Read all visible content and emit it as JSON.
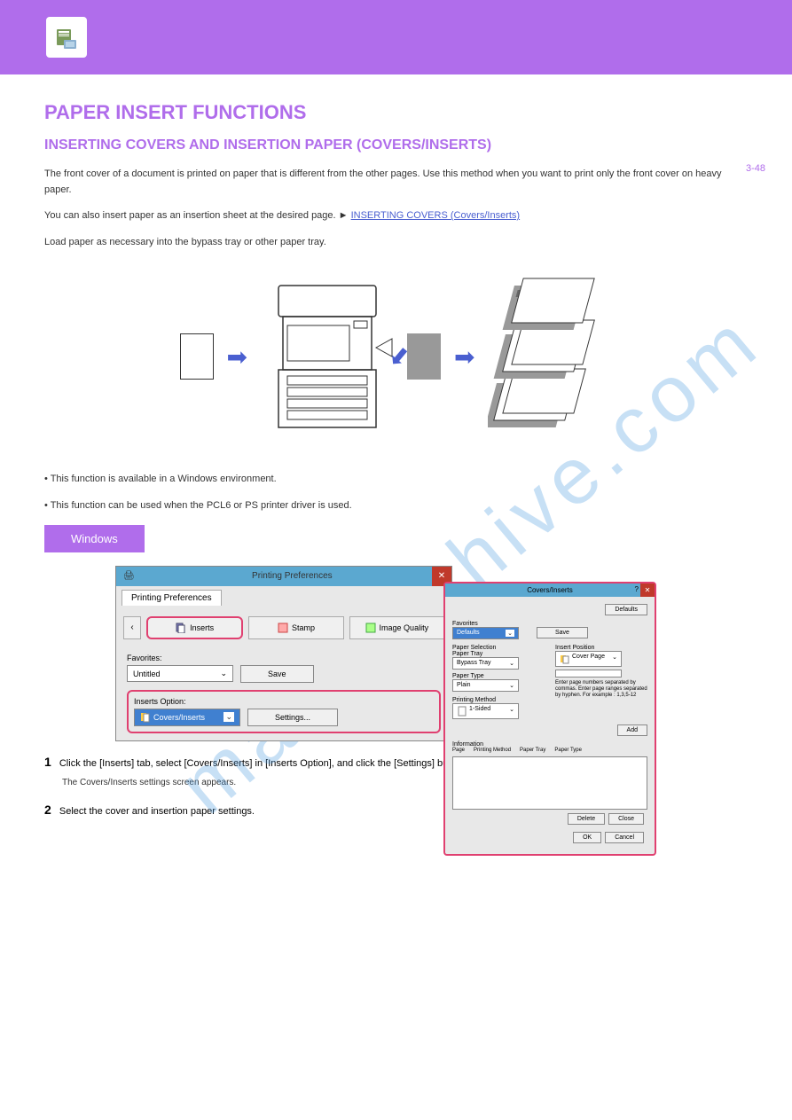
{
  "header": {
    "page_ref": "3-48"
  },
  "section": {
    "title": "PAPER INSERT FUNCTIONS",
    "subtitle": "INSERTING COVERS AND INSERTION PAPER (COVERS/INSERTS)",
    "link_text": "INSERTING COVERS (Covers/Inserts)",
    "para1": "The front cover of a document is printed on paper that is different from the other pages. Use this method when you want to print only the front cover on heavy paper.",
    "para2_prefix": "You can also insert paper as an insertion sheet at the desired page. ► ",
    "para3": "Load paper as necessary into the bypass tray or other paper tray.",
    "list_item1": "• This function is available in a Windows environment.",
    "list_item2": "• This function can be used when the PCL6 or PS printer driver is used."
  },
  "windows_label": "Windows",
  "screenshot": {
    "window_title": "Printing Preferences",
    "tab_label": "Printing Preferences",
    "tabs": {
      "inserts": "Inserts",
      "stamp": "Stamp",
      "image_quality": "Image Quality"
    },
    "favorites_label": "Favorites:",
    "favorites_value": "Untitled",
    "save_btn": "Save",
    "inserts_option_label": "Inserts Option:",
    "inserts_option_value": "Covers/Inserts",
    "settings_btn": "Settings..."
  },
  "callout": {
    "title": "Covers/Inserts",
    "defaults_btn": "Defaults",
    "favorites_label": "Favorites",
    "favorites_value": "Defaults",
    "save_btn": "Save",
    "paper_selection_label": "Paper Selection",
    "paper_tray_label": "Paper Tray",
    "paper_tray_value": "Bypass Tray",
    "paper_type_label": "Paper Type",
    "paper_type_value": "Plain",
    "printing_method_label": "Printing Method",
    "printing_method_value": "1-Sided",
    "insert_position_label": "Insert Position",
    "insert_position_value": "Cover Page",
    "hint_text": "Enter page numbers separated by commas. Enter page ranges separated by hyphen. For example : 1,3,5-12",
    "add_btn": "Add",
    "information_label": "Information",
    "col_page": "Page",
    "col_method": "Printing Method",
    "col_tray": "Paper Tray",
    "col_type": "Paper Type",
    "delete_btn": "Delete",
    "close_btn": "Close",
    "ok_btn": "OK",
    "cancel_btn": "Cancel"
  },
  "steps": {
    "step1_num": "1",
    "step1_text": "Click the [Inserts] tab, select [Covers/Inserts] in [Inserts Option], and click the [Settings] button.",
    "step1_sub": "The Covers/Inserts settings screen appears.",
    "step2_num": "2",
    "step2_text": "Select the cover and insertion paper settings."
  }
}
